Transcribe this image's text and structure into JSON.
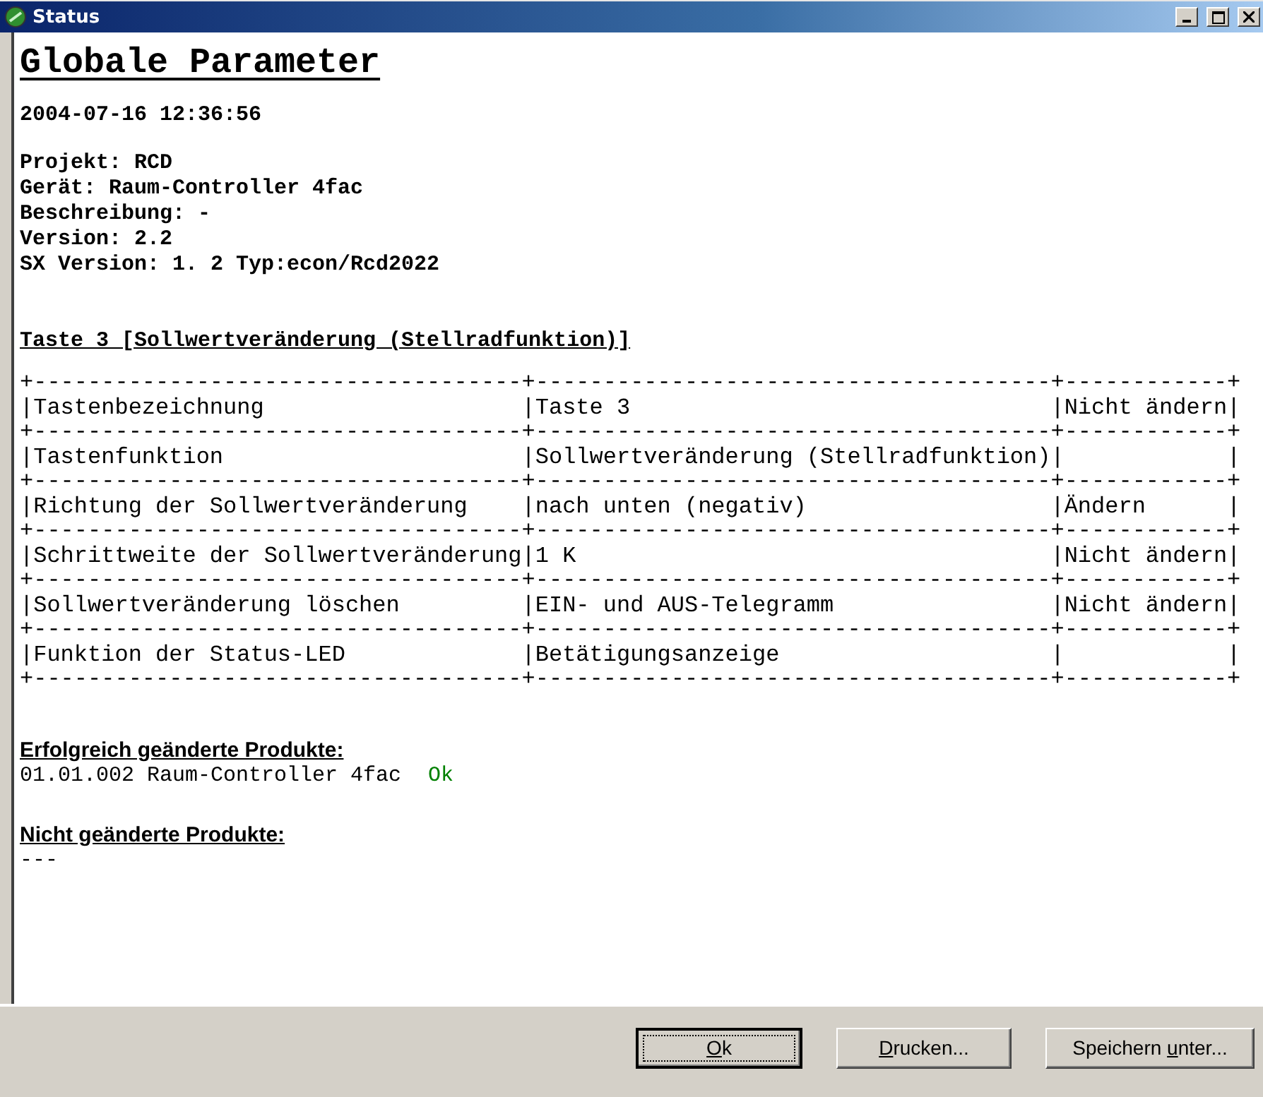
{
  "window": {
    "title": "Status"
  },
  "report": {
    "title": "Globale Parameter",
    "timestamp": "2004-07-16 12:36:56",
    "info_lines": [
      "Projekt: RCD",
      "Gerät: Raum-Controller 4fac",
      "Beschreibung: -",
      "Version: 2.2",
      "SX Version: 1. 2 Typ:econ/Rcd2022"
    ],
    "section_title": "Taste 3 [Sollwertveränderung (Stellradfunktion)]",
    "table_lines": [
      "+------------------------------------+--------------------------------------+------------+",
      "|Tastenbezeichnung                   |Taste 3                               |Nicht ändern|",
      "+------------------------------------+--------------------------------------+------------+",
      "|Tastenfunktion                      |Sollwertveränderung (Stellradfunktion)|            |",
      "+------------------------------------+--------------------------------------+------------+",
      "|Richtung der Sollwertveränderung    |nach unten (negativ)                  |Ändern      |",
      "+------------------------------------+--------------------------------------+------------+",
      "|Schrittweite der Sollwertveränderung|1 K                                   |Nicht ändern|",
      "+------------------------------------+--------------------------------------+------------+",
      "|Sollwertveränderung löschen         |EIN- und AUS-Telegramm                |Nicht ändern|",
      "+------------------------------------+--------------------------------------+------------+",
      "|Funktion der Status-LED             |Betätigungsanzeige                    |            |",
      "+------------------------------------+--------------------------------------+------------+"
    ]
  },
  "results": [
    {
      "heading": "Erfolgreich geänderte Produkte:",
      "lines": [
        {
          "text": "01.01.002 Raum-Controller 4fac",
          "status": "Ok"
        }
      ]
    },
    {
      "heading": "Nicht geänderte Produkte:",
      "lines": [
        {
          "text": "---"
        }
      ]
    }
  ],
  "buttons": [
    {
      "key": "O",
      "post": "k",
      "default": true
    },
    {
      "key": "D",
      "post": "rucken...",
      "default": false
    },
    {
      "pre": "Speichern ",
      "key": "u",
      "post": "nter...",
      "default": false
    }
  ]
}
